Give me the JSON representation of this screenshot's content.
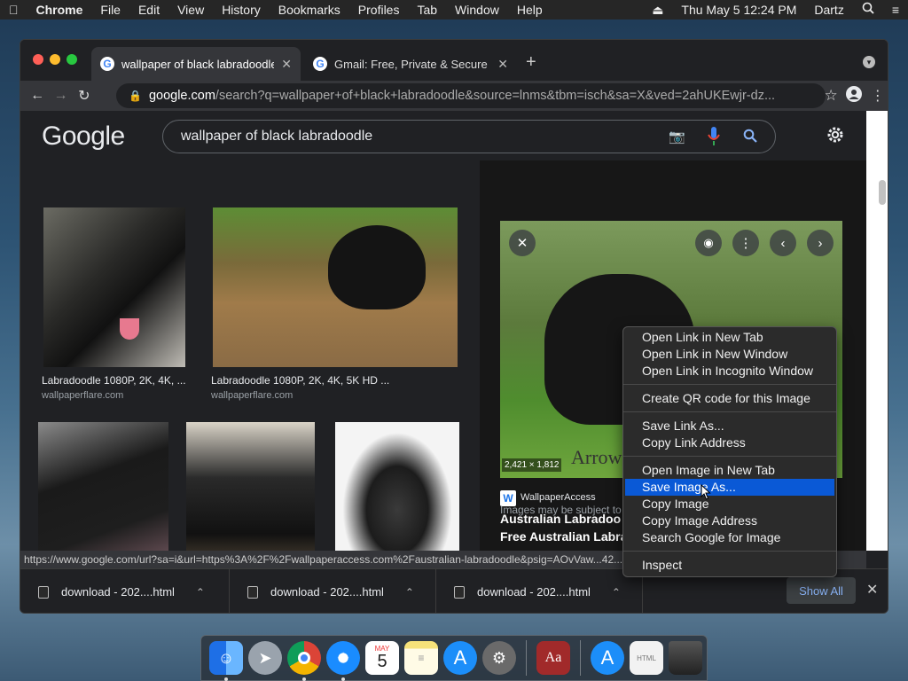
{
  "menubar": {
    "apple": "",
    "items": [
      "Chrome",
      "File",
      "Edit",
      "View",
      "History",
      "Bookmarks",
      "Profiles",
      "Tab",
      "Window",
      "Help"
    ],
    "datetime": "Thu May 5  12:24 PM",
    "user": "Dartz"
  },
  "tabs": [
    {
      "title": "wallpaper of black labradoodle"
    },
    {
      "title": "Gmail: Free, Private & Secure E"
    }
  ],
  "omnibox": {
    "host": "google.com",
    "path": "/search?q=wallpaper+of+black+labradoodle&source=lnms&tbm=isch&sa=X&ved=2ahUKEwjr-dz..."
  },
  "google": {
    "logo": "Google",
    "query": "wallpaper of black labradoodle"
  },
  "results": [
    {
      "caption": "Labradoodle 1080P, 2K, 4K, ...",
      "source": "wallpaperflare.com"
    },
    {
      "caption": "Labradoodle 1080P, 2K, 4K, 5K HD ...",
      "source": "wallpaperflare.com"
    }
  ],
  "preview": {
    "dimensions": "2,421 × 1,812",
    "source_name": "WallpaperAccess",
    "title_line1": "Australian Labradoo",
    "title_line2": "Free Australian Labra",
    "notice": "Images may be subject to"
  },
  "status_url": "https://www.google.com/url?sa=i&url=https%3A%2F%2Fwallpaperaccess.com%2Faustralian-labradoodle&psig=AOvVaw...42...",
  "downloads": [
    {
      "name": "download - 202....html"
    },
    {
      "name": "download - 202....html"
    },
    {
      "name": "download - 202....html"
    }
  ],
  "show_all": "Show All",
  "context_menu": {
    "group1": [
      "Open Link in New Tab",
      "Open Link in New Window",
      "Open Link in Incognito Window"
    ],
    "group2": [
      "Create QR code for this Image"
    ],
    "group3": [
      "Save Link As...",
      "Copy Link Address"
    ],
    "group4": [
      "Open Image in New Tab",
      "Save Image As...",
      "Copy Image",
      "Copy Image Address",
      "Search Google for Image"
    ],
    "group5": [
      "Inspect"
    ],
    "selected": "Save Image As..."
  },
  "dock": {
    "calendar_month": "MAY",
    "calendar_day": "5"
  },
  "colors": {
    "accent": "#0a59d6",
    "link": "#8ab4f8",
    "page_bg": "#202124"
  }
}
